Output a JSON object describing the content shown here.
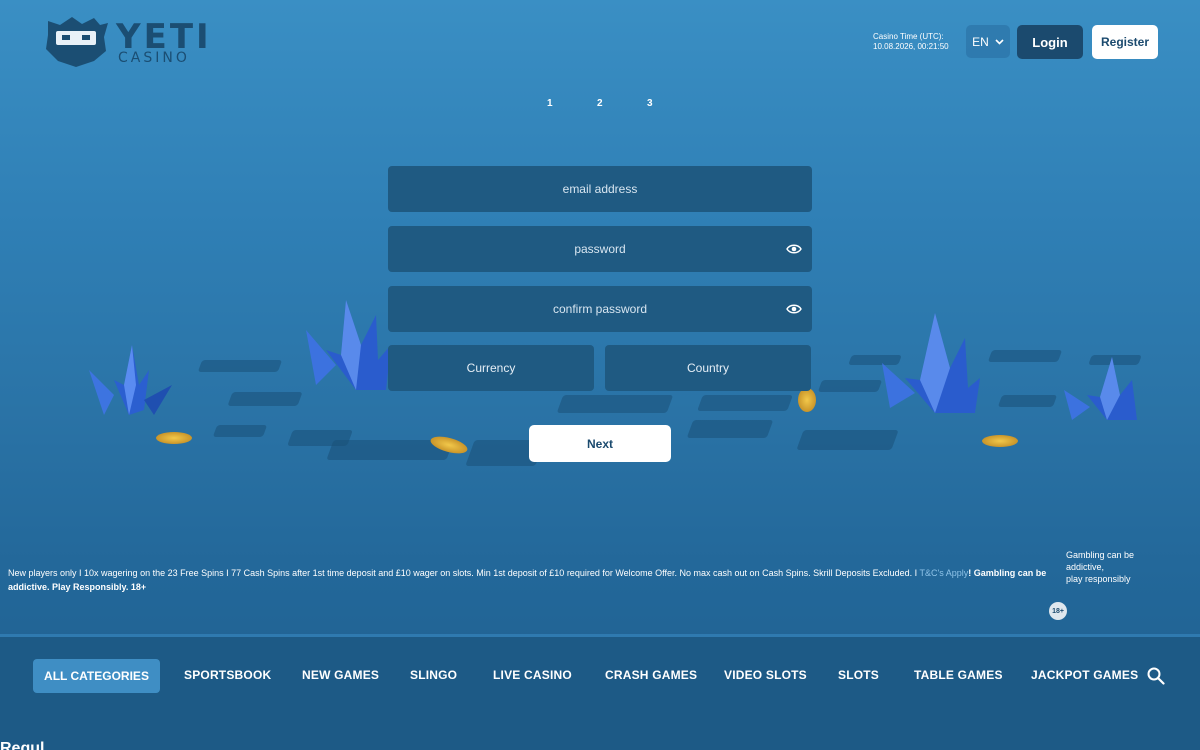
{
  "header": {
    "logo_word": "YETI",
    "logo_sub": "CASINO",
    "casino_time_label": "Casino Time (UTC):",
    "casino_time_value": "10.08.2026, 00:21:50",
    "language": "EN",
    "login_label": "Login",
    "register_label": "Register"
  },
  "steps": [
    "1",
    "2",
    "3"
  ],
  "form": {
    "email_placeholder": "email address",
    "password_placeholder": "password",
    "confirm_password_placeholder": "confirm password",
    "currency_label": "Currency",
    "country_label": "Country",
    "next_label": "Next"
  },
  "disclaimer": {
    "text": "New players only I 10x wagering on the 23 Free Spins I 77 Cash Spins after 1st time deposit and £10 wager on slots. Min 1st deposit of £10 required for Welcome Offer. No max cash out on Cash Spins. Skrill Deposits Excluded. I ",
    "tc_link": "T&C's Apply",
    "bold_text": "! Gambling can be addictive. Play Responsibly. 18+"
  },
  "responsible": {
    "line1": "Gambling can be",
    "line2": "addictive,",
    "line3": "play responsibly",
    "age_badge": "18+"
  },
  "categories": {
    "active": "ALL CATEGORIES",
    "items": [
      "SPORTSBOOK",
      "NEW GAMES",
      "SLINGO",
      "LIVE CASINO",
      "CRASH GAMES",
      "VIDEO SLOTS",
      "SLOTS",
      "TABLE GAMES",
      "JACKPOT GAMES"
    ]
  },
  "bottom_heading": "Regul"
}
